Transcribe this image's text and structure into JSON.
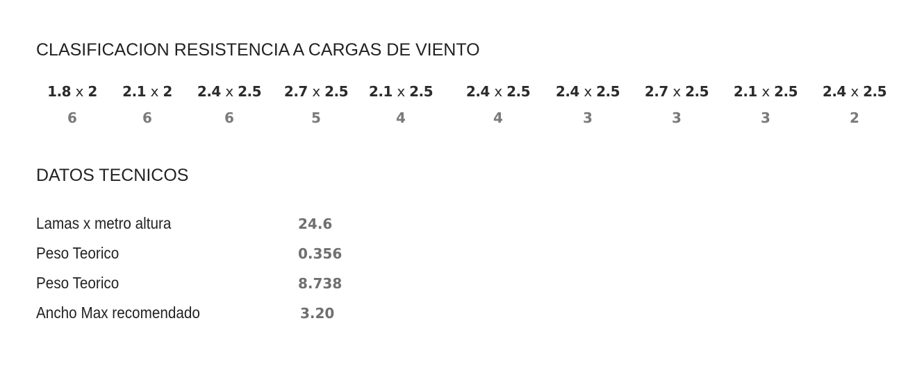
{
  "wind_section": {
    "title": "CLASIFICACION RESISTENCIA A CARGAS DE VIENTO",
    "columns": [
      {
        "w": "1.8",
        "h": "2",
        "class": "6"
      },
      {
        "w": "2.1",
        "h": "2",
        "class": "6"
      },
      {
        "w": "2.4",
        "h": "2.5",
        "class": "6"
      },
      {
        "w": "2.7",
        "h": "2.5",
        "class": "5"
      },
      {
        "w": "2.1",
        "h": "2.5",
        "class": "4"
      },
      {
        "w": "2.4",
        "h": "2.5",
        "class": "4"
      },
      {
        "w": "2.4",
        "h": "2.5",
        "class": "3"
      },
      {
        "w": "2.7",
        "h": "2.5",
        "class": "3"
      },
      {
        "w": "2.1",
        "h": "2.5",
        "class": "3"
      },
      {
        "w": "2.4",
        "h": "2.5",
        "class": "2"
      }
    ],
    "separator": "x"
  },
  "tech_section": {
    "title": "DATOS TECNICOS",
    "rows": [
      {
        "label": "Lamas x metro altura",
        "value": "24.6"
      },
      {
        "label": "Peso Teorico",
        "value": "0.356"
      },
      {
        "label": "Peso Teorico",
        "value": "8.738"
      },
      {
        "label": "Ancho Max recomendado",
        "value": "3.20"
      }
    ]
  }
}
